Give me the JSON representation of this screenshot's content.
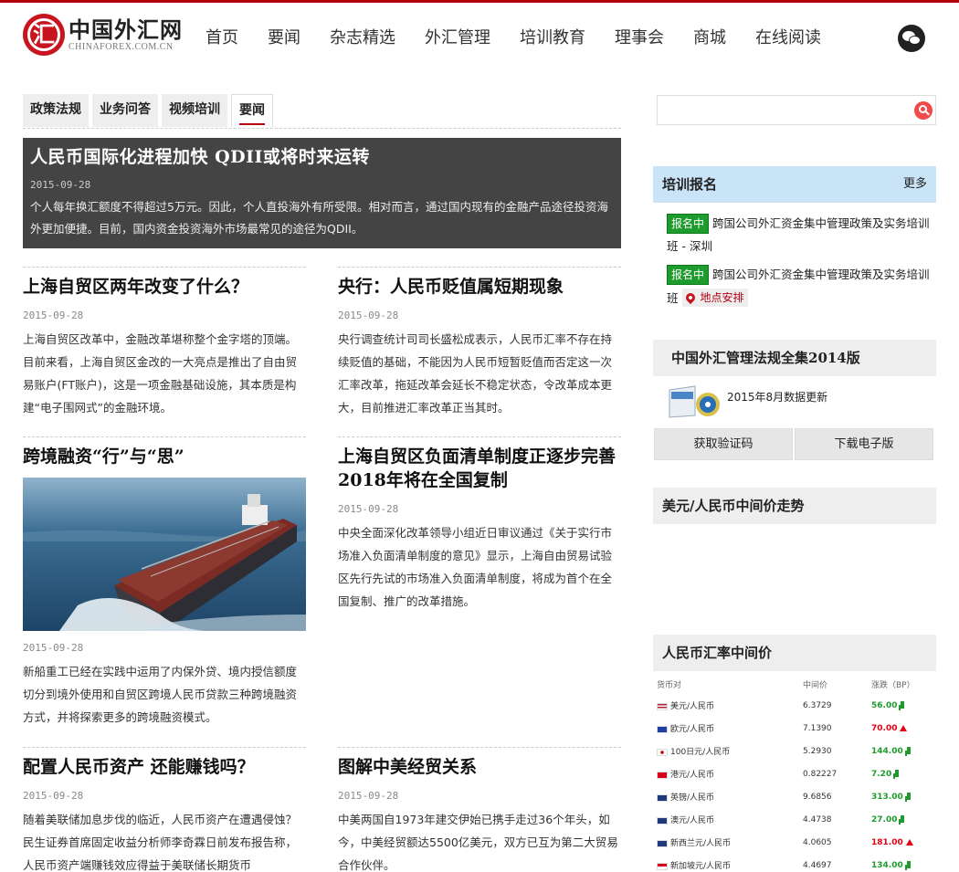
{
  "brand": {
    "name_cn": "中国外汇网",
    "name_en": "CHINAFOREX.COM.CN",
    "logo_glyph": "汇"
  },
  "nav": [
    "首页",
    "要闻",
    "杂志精选",
    "外汇管理",
    "培训教育",
    "理事会",
    "商城",
    "在线阅读"
  ],
  "tabs": [
    "政策法规",
    "业务问答",
    "视频培训",
    "要闻"
  ],
  "featured": {
    "title": "人民币国际化进程加快 QDII或将时来运转",
    "date": "2015-09-28",
    "text": "个人每年换汇额度不得超过5万元。因此，个人直投海外有所受限。相对而言，通过国内现有的金融产品途径投资海外更加便捷。目前，国内资金投资海外市场最常见的途径为QDII。"
  },
  "articles": [
    {
      "title": "上海自贸区两年改变了什么？",
      "date": "2015-09-28",
      "text": "上海自贸区改革中，金融改革堪称整个金字塔的顶端。目前来看，上海自贸区金改的一大亮点是推出了自由贸易账户(FT账户)，这是一项金融基础设施，其本质是构建“电子围网式”的金融环境。"
    },
    {
      "title": "央行：人民币贬值属短期现象",
      "date": "2015-09-28",
      "text": "央行调查统计司司长盛松成表示，人民币汇率不存在持续贬值的基础，不能因为人民币短暂贬值而否定这一次汇率改革，拖延改革会延长不稳定状态，令改革成本更大，目前推进汇率改革正当其时。"
    },
    {
      "title": "跨境融资“行”与“思”",
      "date": "2015-09-28",
      "text": "新船重工已经在实践中运用了内保外贷、境内授信额度切分到境外使用和自贸区跨境人民币贷款三种跨境融资方式，并将探索更多的跨境融资模式。"
    },
    {
      "title": "上海自贸区负面清单制度正逐步完善 2018年将在全国复制",
      "date": "2015-09-28",
      "text": "中央全面深化改革领导小组近日审议通过《关于实行市场准入负面清单制度的意见》显示，上海自由贸易试验区先行先试的市场准入负面清单制度，将成为首个在全国复制、推广的改革措施。"
    },
    {
      "title": "配置人民币资产 还能赚钱吗？",
      "date": "2015-09-28",
      "text": "随着美联储加息步伐的临近，人民币资产在遭遇侵蚀？民生证券首席固定收益分析师李奇霖日前发布报告称，人民币资产端赚钱效应得益于美联储长期货币"
    },
    {
      "title": "图解中美经贸关系",
      "date": "2015-09-28",
      "text": "中美两国自1973年建交伊始已携手走过36个年头，如今，中美经贸额达5500亿美元，双方已互为第二大贸易合作伙伴。"
    }
  ],
  "search": {
    "placeholder": ""
  },
  "training": {
    "title": "培训报名",
    "more": "更多",
    "items": [
      {
        "badge": "报名中",
        "text": "跨国公司外汇资金集中管理政策及实务培训班 - 深圳"
      },
      {
        "badge": "报名中",
        "text": "跨国公司外汇资金集中管理政策及实务培训班",
        "location": "地点安排"
      }
    ]
  },
  "regulations": {
    "title": "中国外汇管理法规全集2014版",
    "update": "2015年8月数据更新",
    "btn_code": "获取验证码",
    "btn_download": "下载电子版"
  },
  "trend": {
    "title": "美元/人民币中间价走势"
  },
  "rates": {
    "title": "人民币汇率中间价",
    "headers": [
      "货币对",
      "中间价",
      "涨跌（BP）"
    ],
    "rows": [
      {
        "pair": "美元/人民币",
        "price": "6.3729",
        "change": "56.00",
        "dir": "down",
        "flag": "us"
      },
      {
        "pair": "欧元/人民币",
        "price": "7.1390",
        "change": "70.00",
        "dir": "up",
        "flag": "eu"
      },
      {
        "pair": "100日元/人民币",
        "price": "5.2930",
        "change": "144.00",
        "dir": "down",
        "flag": "jp"
      },
      {
        "pair": "港元/人民币",
        "price": "0.82227",
        "change": "7.20",
        "dir": "down",
        "flag": "hk"
      },
      {
        "pair": "英镑/人民币",
        "price": "9.6856",
        "change": "313.00",
        "dir": "down",
        "flag": "gb"
      },
      {
        "pair": "澳元/人民币",
        "price": "4.4738",
        "change": "27.00",
        "dir": "down",
        "flag": "au"
      },
      {
        "pair": "新西兰元/人民币",
        "price": "4.0605",
        "change": "181.00",
        "dir": "up",
        "flag": "nz"
      },
      {
        "pair": "新加坡元/人民币",
        "price": "4.4697",
        "change": "134.00",
        "dir": "down",
        "flag": "sg"
      }
    ]
  },
  "colors": {
    "brand_red": "#b5000f",
    "panel_blue": "#c9e3f7",
    "up": "#e60012",
    "down": "#1e9b2d"
  }
}
